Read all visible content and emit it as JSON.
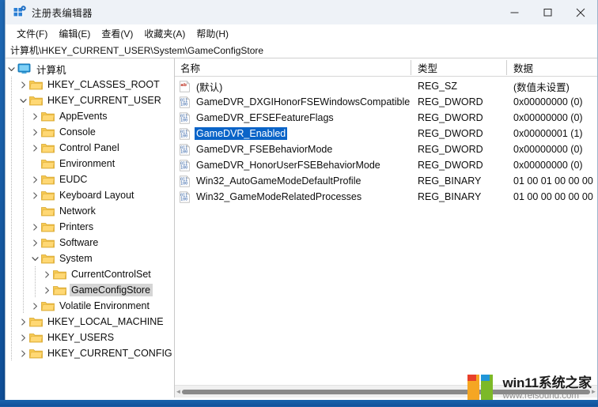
{
  "window": {
    "title": "注册表编辑器",
    "app_icon": "registry-editor-icon",
    "minimize_label": "最小化",
    "maximize_label": "最大化",
    "close_label": "关闭"
  },
  "menubar": {
    "items": [
      {
        "label": "文件(F)"
      },
      {
        "label": "编辑(E)"
      },
      {
        "label": "查看(V)"
      },
      {
        "label": "收藏夹(A)"
      },
      {
        "label": "帮助(H)"
      }
    ]
  },
  "address": {
    "path": "计算机\\HKEY_CURRENT_USER\\System\\GameConfigStore"
  },
  "tree": {
    "items": [
      {
        "label": "计算机",
        "depth": 0,
        "state": "expanded",
        "icon": "computer-icon",
        "selected": false
      },
      {
        "label": "HKEY_CLASSES_ROOT",
        "depth": 1,
        "state": "collapsed",
        "icon": "folder-icon",
        "selected": false
      },
      {
        "label": "HKEY_CURRENT_USER",
        "depth": 1,
        "state": "expanded",
        "icon": "folder-icon",
        "selected": false
      },
      {
        "label": "AppEvents",
        "depth": 2,
        "state": "collapsed",
        "icon": "folder-icon",
        "selected": false
      },
      {
        "label": "Console",
        "depth": 2,
        "state": "collapsed",
        "icon": "folder-icon",
        "selected": false
      },
      {
        "label": "Control Panel",
        "depth": 2,
        "state": "collapsed",
        "icon": "folder-icon",
        "selected": false
      },
      {
        "label": "Environment",
        "depth": 2,
        "state": "leaf",
        "icon": "folder-icon",
        "selected": false
      },
      {
        "label": "EUDC",
        "depth": 2,
        "state": "collapsed",
        "icon": "folder-icon",
        "selected": false
      },
      {
        "label": "Keyboard Layout",
        "depth": 2,
        "state": "collapsed",
        "icon": "folder-icon",
        "selected": false
      },
      {
        "label": "Network",
        "depth": 2,
        "state": "leaf",
        "icon": "folder-icon",
        "selected": false
      },
      {
        "label": "Printers",
        "depth": 2,
        "state": "collapsed",
        "icon": "folder-icon",
        "selected": false
      },
      {
        "label": "Software",
        "depth": 2,
        "state": "collapsed",
        "icon": "folder-icon",
        "selected": false
      },
      {
        "label": "System",
        "depth": 2,
        "state": "expanded",
        "icon": "folder-icon",
        "selected": false
      },
      {
        "label": "CurrentControlSet",
        "depth": 3,
        "state": "collapsed",
        "icon": "folder-icon",
        "selected": false
      },
      {
        "label": "GameConfigStore",
        "depth": 3,
        "state": "collapsed",
        "icon": "folder-icon",
        "selected": true
      },
      {
        "label": "Volatile Environment",
        "depth": 2,
        "state": "collapsed",
        "icon": "folder-icon",
        "selected": false
      },
      {
        "label": "HKEY_LOCAL_MACHINE",
        "depth": 1,
        "state": "collapsed",
        "icon": "folder-icon",
        "selected": false
      },
      {
        "label": "HKEY_USERS",
        "depth": 1,
        "state": "collapsed",
        "icon": "folder-icon",
        "selected": false
      },
      {
        "label": "HKEY_CURRENT_CONFIG",
        "depth": 1,
        "state": "collapsed",
        "icon": "folder-icon",
        "selected": false
      }
    ]
  },
  "list": {
    "columns": [
      {
        "label": "名称"
      },
      {
        "label": "类型"
      },
      {
        "label": "数据"
      }
    ],
    "rows": [
      {
        "name": "(默认)",
        "type": "REG_SZ",
        "data": "(数值未设置)",
        "icon": "string-value-icon",
        "selected": false
      },
      {
        "name": "GameDVR_DXGIHonorFSEWindowsCompatible",
        "type": "REG_DWORD",
        "data": "0x00000000 (0)",
        "icon": "binary-value-icon",
        "selected": false
      },
      {
        "name": "GameDVR_EFSEFeatureFlags",
        "type": "REG_DWORD",
        "data": "0x00000000 (0)",
        "icon": "binary-value-icon",
        "selected": false
      },
      {
        "name": "GameDVR_Enabled",
        "type": "REG_DWORD",
        "data": "0x00000001 (1)",
        "icon": "binary-value-icon",
        "selected": true
      },
      {
        "name": "GameDVR_FSEBehaviorMode",
        "type": "REG_DWORD",
        "data": "0x00000000 (0)",
        "icon": "binary-value-icon",
        "selected": false
      },
      {
        "name": "GameDVR_HonorUserFSEBehaviorMode",
        "type": "REG_DWORD",
        "data": "0x00000000 (0)",
        "icon": "binary-value-icon",
        "selected": false
      },
      {
        "name": "Win32_AutoGameModeDefaultProfile",
        "type": "REG_BINARY",
        "data": "01 00 01 00 00 00",
        "icon": "binary-value-icon",
        "selected": false
      },
      {
        "name": "Win32_GameModeRelatedProcesses",
        "type": "REG_BINARY",
        "data": "01 00 00 00 00 00",
        "icon": "binary-value-icon",
        "selected": false
      }
    ]
  },
  "scrollbar": {
    "left_arrow": "◄",
    "right_arrow": "►"
  },
  "watermark": {
    "title": "win11系统之家",
    "url": "www.relsound.com",
    "logo": "win11-logo-icon",
    "colors": {
      "red": "#e8402a",
      "orange": "#f5a623",
      "blue": "#2196d8",
      "green": "#7cb928"
    }
  },
  "theme": {
    "titlebar_bg": "#eef2f7",
    "selection_blue": "#0a64c8",
    "tree_selection_gray": "#d5d5d5",
    "desktop_blue": "#1a63ac"
  }
}
